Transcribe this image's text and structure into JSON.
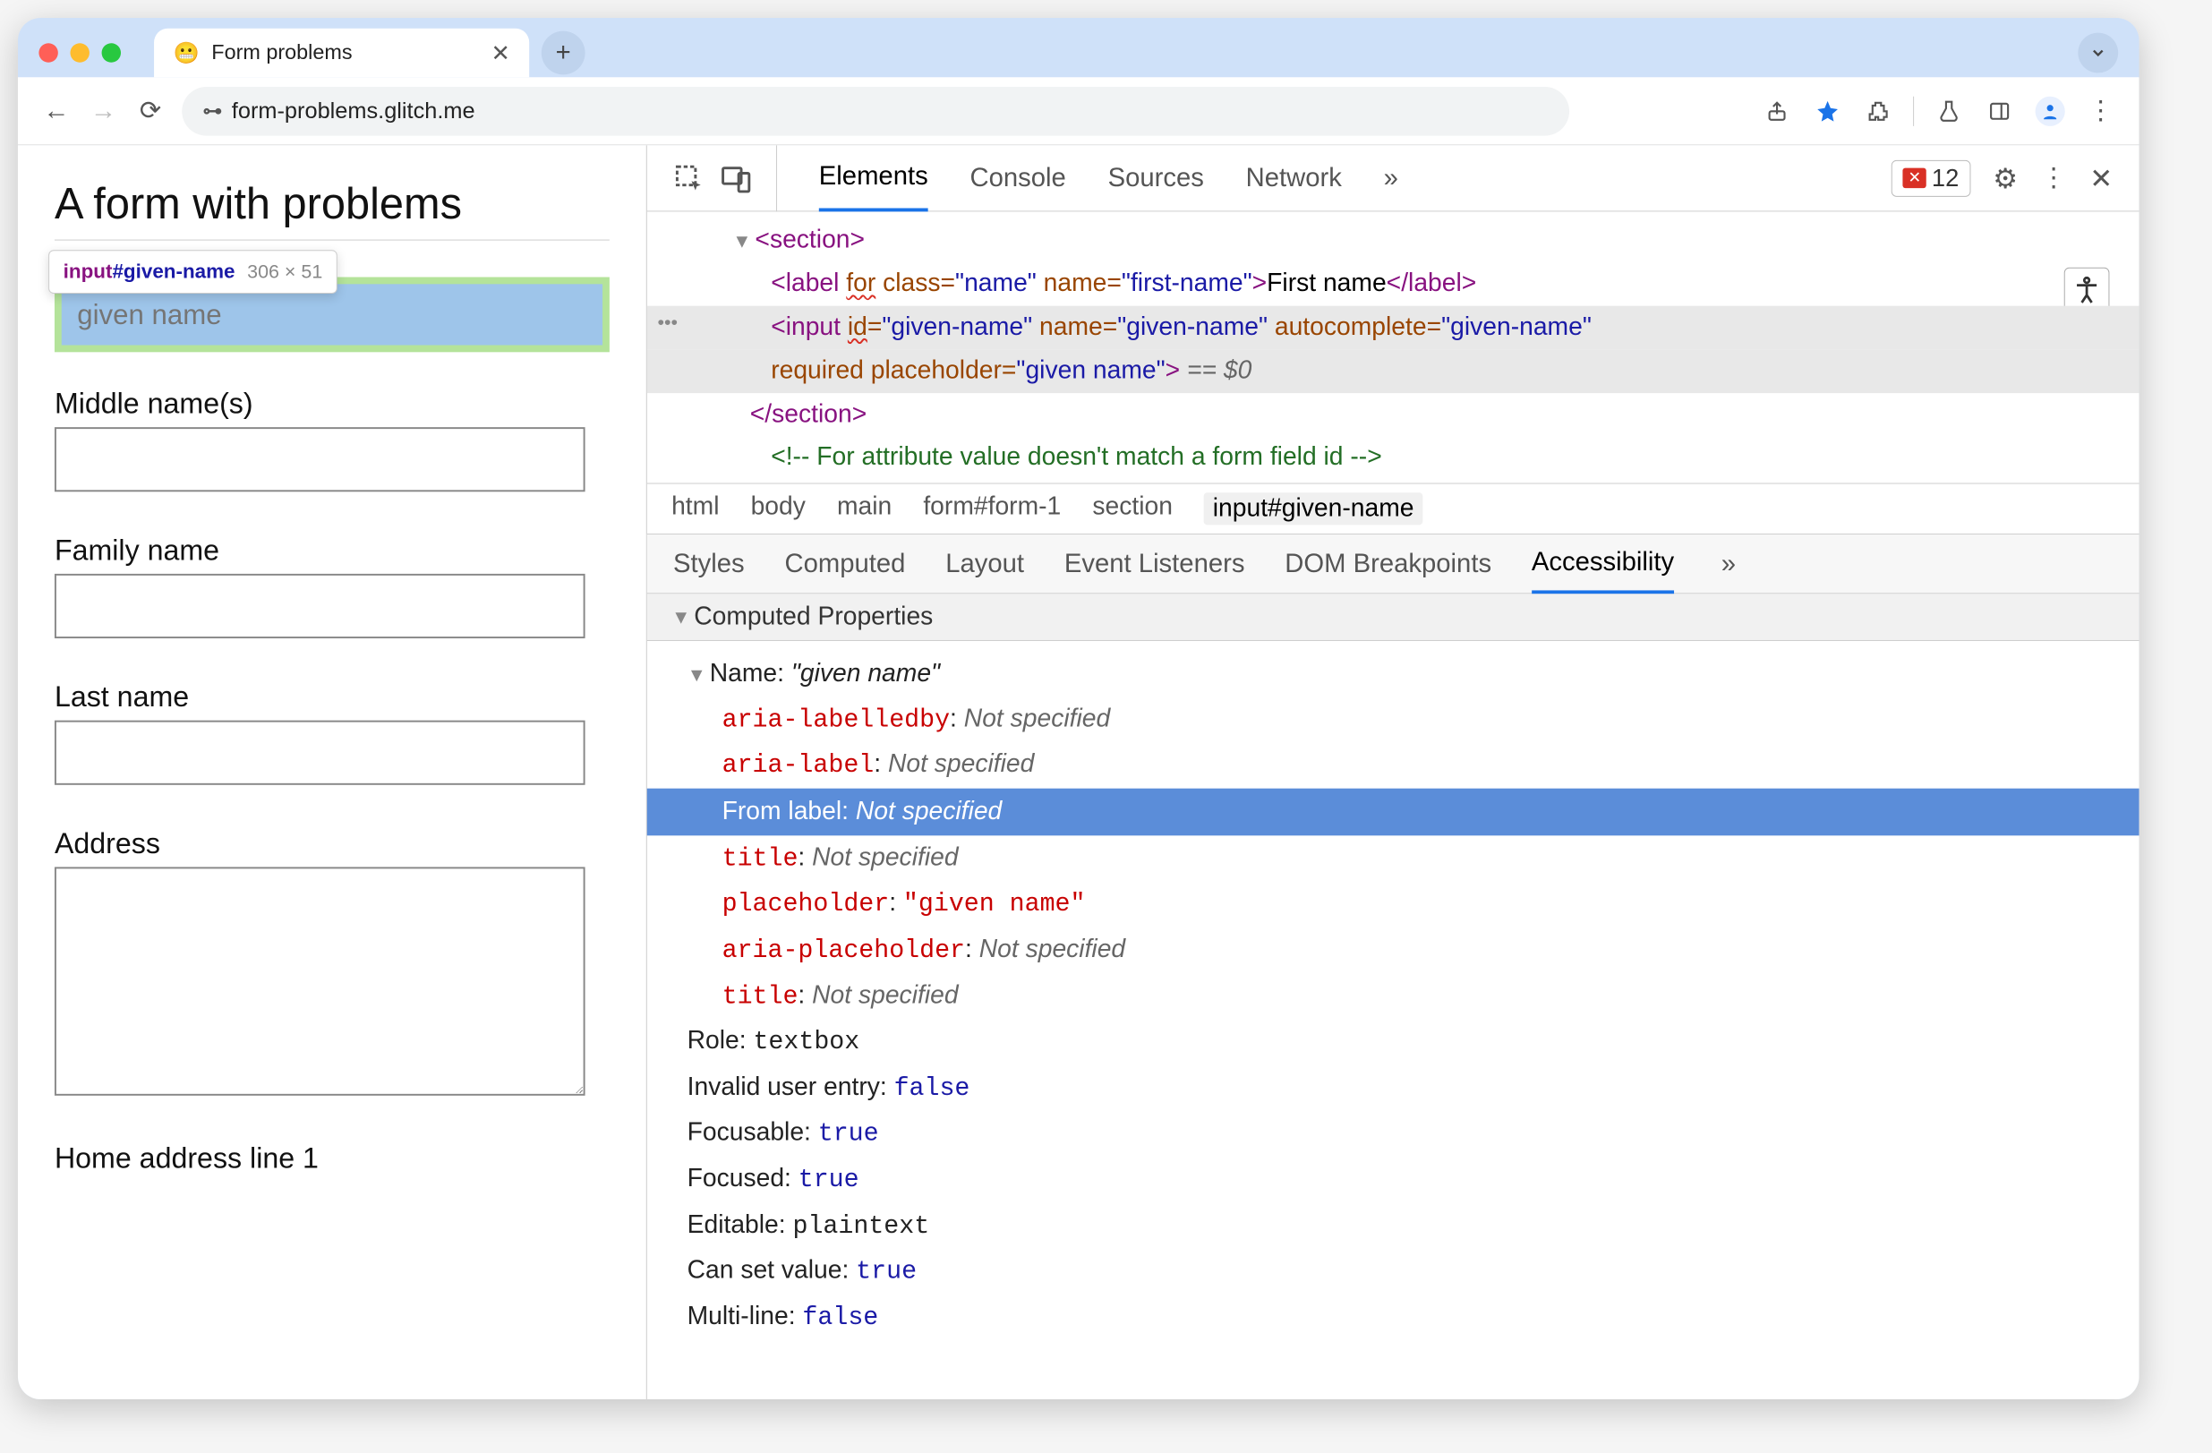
{
  "browser": {
    "tab_title": "Form problems",
    "tab_favicon": "😬",
    "omnibox_prefix": "⚙",
    "omnibox_url": "form-problems.glitch.me"
  },
  "toolbar": {
    "error_count": "12"
  },
  "page": {
    "title": "A form with problems",
    "tooltip_selector_tag": "input",
    "tooltip_selector_id": "#given-name",
    "tooltip_dims": "306 × 51",
    "highlighted_placeholder": "given name",
    "labels": {
      "middle": "Middle name(s)",
      "family": "Family name",
      "last": "Last name",
      "address": "Address",
      "home1": "Home address line 1"
    }
  },
  "devtools": {
    "tabs": [
      "Elements",
      "Console",
      "Sources",
      "Network"
    ],
    "active_tab": "Elements",
    "breadcrumbs": [
      "html",
      "body",
      "main",
      "form#form-1",
      "section",
      "input#given-name"
    ],
    "active_crumb": "input#given-name",
    "subtabs": [
      "Styles",
      "Computed",
      "Layout",
      "Event Listeners",
      "DOM Breakpoints",
      "Accessibility"
    ],
    "active_subtab": "Accessibility"
  },
  "dom": {
    "section_open": "<section>",
    "label_line_prefix": "<label ",
    "label_for": "for",
    "label_rest1": " class=",
    "label_cls": "\"name\"",
    "label_rest2": " name=",
    "label_name": "\"first-name\"",
    "label_close": ">",
    "label_text": "First name",
    "label_end": "</label>",
    "input_prefix": "<input ",
    "input_id_attr": "id",
    "input_id_val": "\"given-name\"",
    "input_name_attr": " name=",
    "input_name_val": "\"given-name\"",
    "input_ac_attr": " autocomplete=",
    "input_ac_val": "\"given-name\"",
    "input_req": "required",
    "input_ph_attr": " placeholder=",
    "input_ph_val": "\"given name\"",
    "input_end": "> ",
    "eq0": "== $0",
    "section_close": "</section>",
    "comment": "<!-- For attribute value doesn't match a form field id -->"
  },
  "a11y": {
    "header": "Computed Properties",
    "name_label": "Name: ",
    "name_value": "\"given name\"",
    "rows": {
      "aria_labelledby_k": "aria-labelledby",
      "aria_labelledby_v": "Not specified",
      "aria_label_k": "aria-label",
      "aria_label_v": "Not specified",
      "from_label_k": "From label: ",
      "from_label_v": "Not specified",
      "title_k": "title",
      "title_v": "Not specified",
      "placeholder_k": "placeholder",
      "placeholder_v": "\"given name\"",
      "aria_placeholder_k": "aria-placeholder",
      "aria_placeholder_v": "Not specified",
      "title2_k": "title",
      "title2_v": "Not specified"
    },
    "props": {
      "role_k": "Role: ",
      "role_v": "textbox",
      "invalid_k": "Invalid user entry: ",
      "invalid_v": "false",
      "focusable_k": "Focusable: ",
      "focusable_v": "true",
      "focused_k": "Focused: ",
      "focused_v": "true",
      "editable_k": "Editable: ",
      "editable_v": "plaintext",
      "cansv_k": "Can set value: ",
      "cansv_v": "true",
      "multi_k": "Multi-line: ",
      "multi_v": "false"
    }
  }
}
